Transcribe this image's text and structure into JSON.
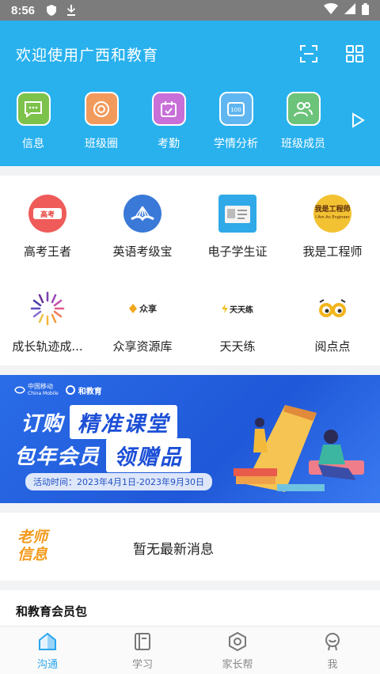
{
  "status_bar": {
    "time": "8:56"
  },
  "header": {
    "title": "欢迎使用广西和教育"
  },
  "quick_actions": [
    {
      "label": "信息",
      "icon": "message-icon",
      "color": "#7dc24b"
    },
    {
      "label": "班级圈",
      "icon": "circle-icon",
      "color": "#f29a5c"
    },
    {
      "label": "考勤",
      "icon": "calendar-check-icon",
      "color": "#c86fd8"
    },
    {
      "label": "学情分析",
      "icon": "score-icon",
      "color": "#5fb6f0"
    },
    {
      "label": "班级成员",
      "icon": "members-icon",
      "color": "#6cc37a"
    }
  ],
  "apps": [
    {
      "label": "高考王者",
      "icon": "gaokao-icon"
    },
    {
      "label": "英语考级宝",
      "icon": "english-book-icon"
    },
    {
      "label": "电子学生证",
      "icon": "student-card-icon"
    },
    {
      "label": "我是工程师",
      "icon": "engineer-icon",
      "logo_text": "我是工程师",
      "logo_sub": "I Am An Engineer"
    },
    {
      "label": "成长轨迹成...",
      "icon": "growth-icon"
    },
    {
      "label": "众享资源库",
      "icon": "resource-icon",
      "logo_text": "众享"
    },
    {
      "label": "天天练",
      "icon": "practice-icon",
      "logo_text": "天天练"
    },
    {
      "label": "阅点点",
      "icon": "reading-icon"
    }
  ],
  "banner": {
    "brand_mobile": "中国移动",
    "brand_mobile_en": "China Mobile",
    "brand_edu": "和教育",
    "line1_plain": "订购",
    "line1_boxed": "精准课堂",
    "line2_plain": "包年会员",
    "line2_boxed": "领赠品",
    "date": "活动时间：2023年4月1日-2023年9月30日"
  },
  "notice": {
    "badge_line1": "老师",
    "badge_line2": "信息",
    "text": "暂无最新消息"
  },
  "member": {
    "title": "和教育会员包"
  },
  "tabs": [
    {
      "label": "沟通",
      "icon": "chat-home-icon",
      "active": true
    },
    {
      "label": "学习",
      "icon": "book-icon",
      "active": false
    },
    {
      "label": "家长帮",
      "icon": "hexagon-icon",
      "active": false
    },
    {
      "label": "我",
      "icon": "profile-icon",
      "active": false
    }
  ],
  "colors": {
    "header": "#29b1ee",
    "accent": "#29a6ee",
    "banner": "#1f58d8",
    "notice_badge": "#f29a1c"
  }
}
